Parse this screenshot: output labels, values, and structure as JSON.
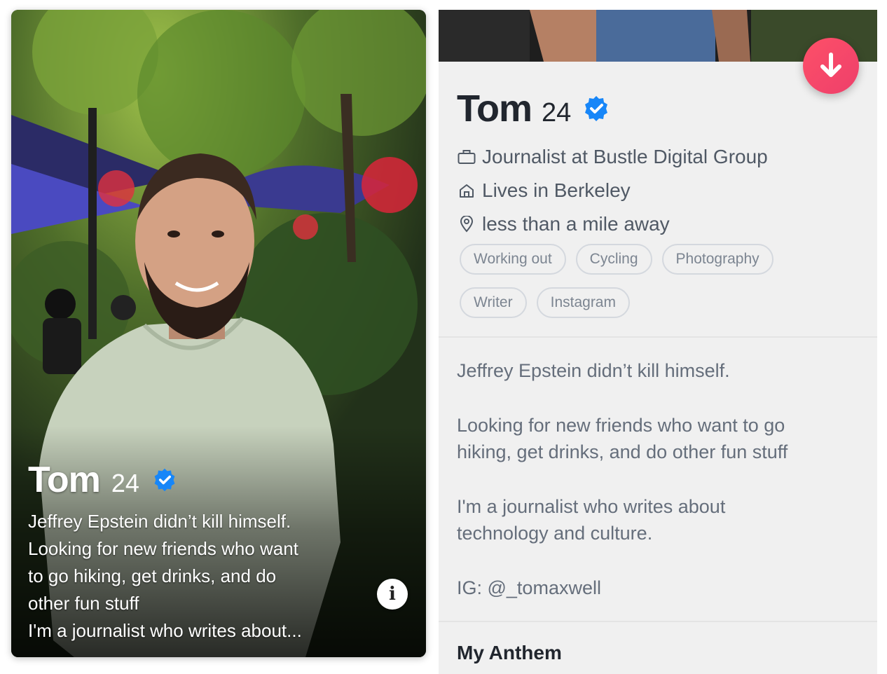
{
  "card": {
    "name": "Tom",
    "age": "24",
    "bio_lines": [
      "Jeffrey Epstein didn’t kill himself.",
      "Looking for new friends who want",
      "to go hiking, get drinks, and do",
      "other fun stuff",
      "I'm a journalist who writes about..."
    ],
    "info_icon": "info-icon",
    "verified_icon": "verified-badge-icon"
  },
  "profile": {
    "name": "Tom",
    "age": "24",
    "facts": [
      {
        "icon": "briefcase-icon",
        "text": "Journalist at Bustle Digital Group"
      },
      {
        "icon": "home-icon",
        "text": "Lives in Berkeley"
      },
      {
        "icon": "location-pin-icon",
        "text": "less than a mile away"
      }
    ],
    "interests_row1": [
      "Working out",
      "Cycling",
      "Photography"
    ],
    "interests_row2": [
      "Writer",
      "Instagram"
    ],
    "bio": [
      "Jeffrey Epstein didn’t kill himself.",
      "Looking for new friends who want to go\nhiking, get drinks, and do other fun stuff",
      "I'm a journalist who writes about\ntechnology and culture.",
      "IG: @_tomaxwell"
    ],
    "anthem_title": "My Anthem",
    "collapse_icon": "arrow-down-icon"
  },
  "colors": {
    "accent_gradient_start": "#fd5068",
    "accent_gradient_end": "#ee3f6b",
    "verified_blue": "#1786f8",
    "panel_bg": "#f0f0f0",
    "heading_text": "#21262e",
    "body_text": "#656e7b"
  }
}
